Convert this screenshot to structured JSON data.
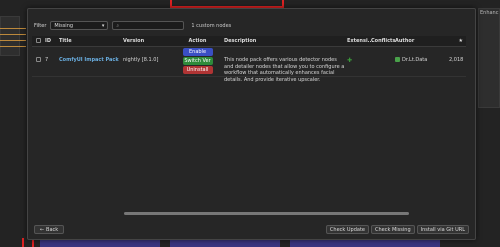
{
  "background": {
    "right_label": "Enhanc",
    "accent": "#e0a040"
  },
  "filter": {
    "label": "Filter",
    "selected": "Missing",
    "search_placeholder": "",
    "count_text": "1 custom nodes"
  },
  "table": {
    "headers": [
      "ID",
      "Title",
      "Version",
      "Action",
      "Description",
      "Extensi...",
      "Conflicts",
      "Author",
      "★"
    ],
    "rows": [
      {
        "id": "7",
        "title": "ComfyUI Impact Pack",
        "version": "nightly [8.1.0]",
        "actions": [
          "Enable",
          "Switch Ver",
          "Uninstall"
        ],
        "description": "This node pack offers various detector nodes and detailer nodes that allow you to configure a workflow that automatically enhances facial details. And provide iterative upscaler.",
        "extension_icon": "puzzle-icon",
        "conflicts": "",
        "author": "Dr.Lt.Data",
        "stars": "2,018"
      }
    ]
  },
  "footer": {
    "back": "Back",
    "buttons": [
      "Check Update",
      "Check Missing",
      "Install via Git URL"
    ]
  },
  "colors": {
    "enable": "#3a4fc4",
    "switch": "#2e8a3a",
    "uninstall": "#b03434",
    "link": "#6aaee0"
  }
}
